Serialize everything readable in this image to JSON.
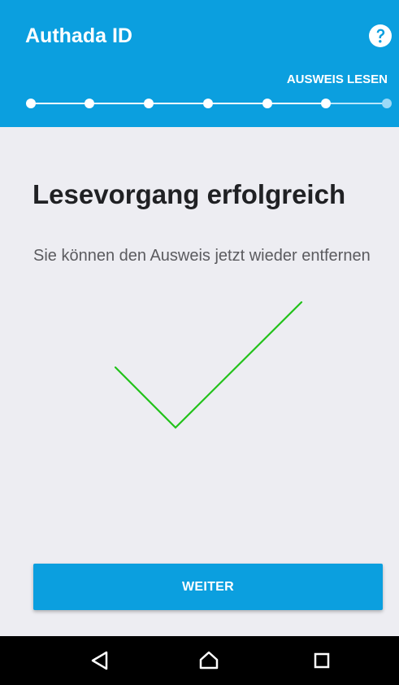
{
  "app": {
    "title": "Authada ID"
  },
  "header": {
    "help_icon": "help-circle-icon",
    "step_label": "AUSWEIS LESEN",
    "progress": {
      "current_step": 7,
      "total_steps": 7
    }
  },
  "content": {
    "title": "Lesevorgang erfolgreich",
    "text": "Sie können den Ausweis jetzt wieder entfernen",
    "success_icon": "checkmark-icon"
  },
  "actions": {
    "next_label": "WEITER"
  },
  "navigation": {
    "back_icon": "back-icon",
    "home_icon": "home-icon",
    "recents_icon": "recents-icon"
  },
  "colors": {
    "primary": "#0b9fdf",
    "background": "#ededf2",
    "success": "#22c21a",
    "title": "#202124",
    "text": "#5b5b5f",
    "nav_bar": "#000000"
  }
}
